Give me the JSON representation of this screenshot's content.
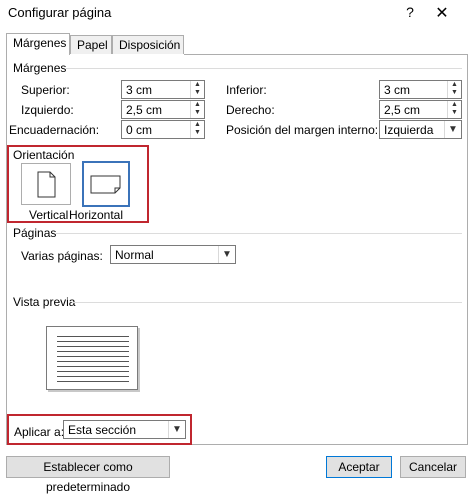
{
  "window": {
    "title": "Configurar página",
    "help_glyph": "?",
    "close_glyph": "✕"
  },
  "tabs": [
    {
      "label": "Márgenes",
      "active": true
    },
    {
      "label": "Papel",
      "active": false
    },
    {
      "label": "Disposición",
      "active": false
    }
  ],
  "margins": {
    "group_label": "Márgenes",
    "superior": {
      "label": "Superior:",
      "value": "3 cm"
    },
    "izquierdo": {
      "label": "Izquierdo:",
      "value": "2,5 cm"
    },
    "encuadernacion": {
      "label": "Encuadernación:",
      "value": "0 cm"
    },
    "inferior": {
      "label": "Inferior:",
      "value": "3 cm"
    },
    "derecho": {
      "label": "Derecho:",
      "value": "2,5 cm"
    },
    "posicion": {
      "label": "Posición del margen interno:",
      "value": "Izquierda"
    }
  },
  "orientation": {
    "group_label": "Orientación",
    "vertical_label": "Vertical",
    "horizontal_label": "Horizontal",
    "selected": "Horizontal"
  },
  "pages": {
    "group_label": "Páginas",
    "varias_label": "Varias páginas:",
    "varias_value": "Normal"
  },
  "preview": {
    "group_label": "Vista previa"
  },
  "apply": {
    "label": "Aplicar a:",
    "value": "Esta sección"
  },
  "buttons": {
    "set_default": "Establecer como predeterminado",
    "accept": "Aceptar",
    "cancel": "Cancelar"
  },
  "colors": {
    "highlight_frame": "#c0262f",
    "selected_border": "#3b73b9",
    "default_button_border": "#0078d7"
  }
}
